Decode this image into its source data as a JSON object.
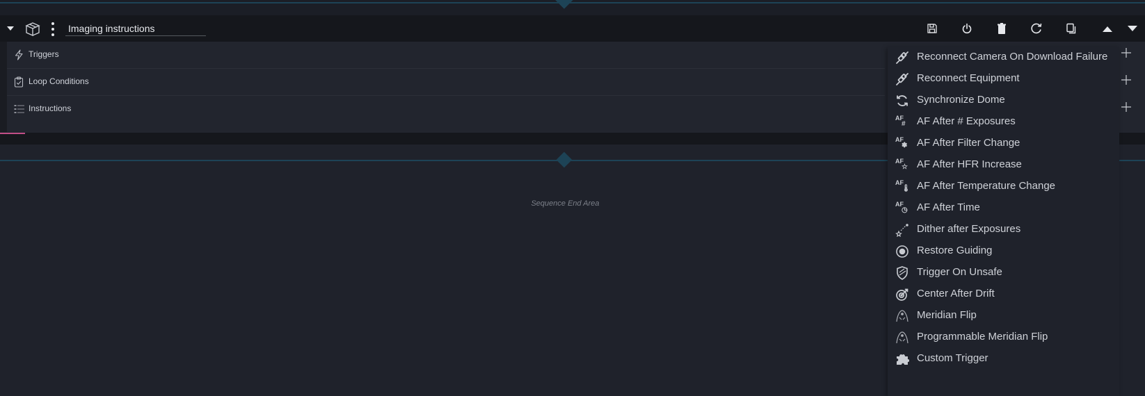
{
  "container": {
    "name_value": "Imaging instructions",
    "sections": [
      {
        "label": "Triggers",
        "icon": "lightning-icon"
      },
      {
        "label": "Loop Conditions",
        "icon": "clipboard-check-icon"
      },
      {
        "label": "Instructions",
        "icon": "list-icon"
      }
    ],
    "toolbar_icons": [
      "save-icon",
      "power-icon",
      "delete-icon",
      "reset-icon",
      "copy-icon",
      "move-up-icon",
      "move-down-icon"
    ]
  },
  "end_area_label": "Sequence End Area",
  "trigger_menu": {
    "items": [
      {
        "label": "Reconnect Camera On Download Failure",
        "icon": "plug-icon"
      },
      {
        "label": "Reconnect Equipment",
        "icon": "plug-icon"
      },
      {
        "label": "Synchronize Dome",
        "icon": "sync-icon"
      },
      {
        "label": "AF After # Exposures",
        "icon": "af-hash-icon"
      },
      {
        "label": "AF After Filter Change",
        "icon": "af-filter-icon"
      },
      {
        "label": "AF After HFR Increase",
        "icon": "af-star-icon"
      },
      {
        "label": "AF After Temperature Change",
        "icon": "af-thermometer-icon"
      },
      {
        "label": "AF After Time",
        "icon": "af-clock-icon"
      },
      {
        "label": "Dither after Exposures",
        "icon": "dither-icon"
      },
      {
        "label": "Restore Guiding",
        "icon": "target-dot-icon"
      },
      {
        "label": "Trigger On Unsafe",
        "icon": "shield-icon"
      },
      {
        "label": "Center After Drift",
        "icon": "bullseye-icon"
      },
      {
        "label": "Meridian Flip",
        "icon": "meridian-flip-icon"
      },
      {
        "label": "Programmable Meridian Flip",
        "icon": "meridian-flip-icon"
      },
      {
        "label": "Custom Trigger",
        "icon": "puzzle-icon"
      }
    ]
  },
  "colors": {
    "background": "#1f222b",
    "header": "#15171c",
    "accent_line": "#1d4356",
    "pink_marker": "#c14e86"
  }
}
